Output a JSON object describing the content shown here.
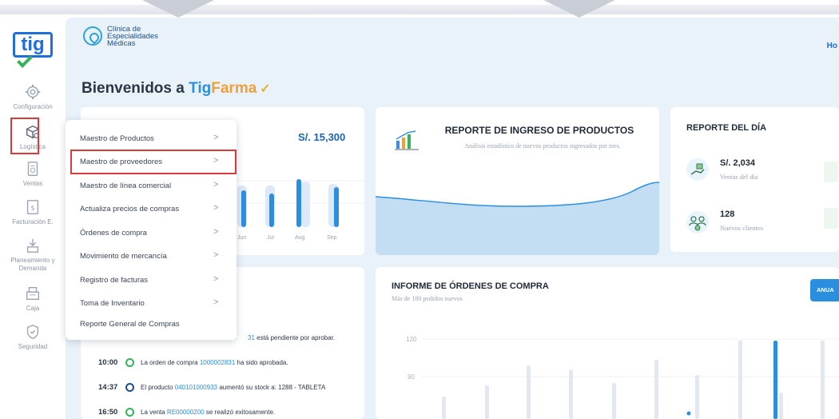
{
  "sidebar": {
    "items": [
      {
        "label": "Configuración",
        "icon": "gear-icon"
      },
      {
        "label": "Logística",
        "icon": "box-icon"
      },
      {
        "label": "Ventas",
        "icon": "receipt-icon"
      },
      {
        "label": "Facturación E.",
        "icon": "invoice-icon"
      },
      {
        "label": "Planeamiento y Demanda",
        "icon": "planning-icon"
      },
      {
        "label": "Caja",
        "icon": "cash-register-icon"
      },
      {
        "label": "Seguridad",
        "icon": "shield-icon"
      }
    ]
  },
  "header": {
    "clinic_name_1": "Clínica de",
    "clinic_name_2": "Especialidades",
    "clinic_name_3": "Médicas",
    "right_cut": "Ho",
    "welcome_prefix": "Bienvenidos a ",
    "brand_tig": "Tig",
    "brand_farma": "Farma",
    "check_mark": "✓"
  },
  "sales_card": {
    "amount": "S/. 15,300",
    "months": [
      "Jun",
      "Jul",
      "Aug",
      "Sep"
    ]
  },
  "report_card": {
    "title": "REPORTE DE INGRESO DE PRODUCTOS",
    "subtitle": "Análisis estadístico de nuevos productos ingresados por mes."
  },
  "day_card": {
    "title": "REPORTE DEL DÍA",
    "sales_value": "S/. 2,034",
    "sales_label": "Ventas del día",
    "clients_value": "128",
    "clients_label": "Nuevos clientes"
  },
  "activity": {
    "partial_link": "31",
    "partial_text": " está pendiente por aprobar.",
    "rows": [
      {
        "time": "10:00",
        "pre": "La orden de compra ",
        "link": "1000002831",
        "post": " ha sido aprobada.",
        "dot": "green"
      },
      {
        "time": "14:37",
        "pre": "El producto ",
        "link": "040101000933",
        "post": " aumentó su stock a: 1288 - TABLETA",
        "dot": "blue"
      },
      {
        "time": "16:50",
        "pre": "La venta ",
        "link": "RE00000200",
        "post": " se realizó exitosamente.",
        "dot": "green"
      }
    ]
  },
  "orders_card": {
    "title": "INFORME DE ÓRDENES DE COMPRA",
    "subtitle": "Más de 180 pedidos nuevos",
    "button": "ANUA",
    "y_ticks": [
      "120",
      "90"
    ]
  },
  "menu": {
    "items": [
      {
        "label": "Maestro de Productos",
        "chevron": ">"
      },
      {
        "label": "Maestro de proveedores",
        "chevron": ">"
      },
      {
        "label": "Maestro de línea comercial",
        "chevron": ">"
      },
      {
        "label": "Actualiza precios de compras",
        "chevron": ">"
      },
      {
        "label": "Órdenes de compra",
        "chevron": ">"
      },
      {
        "label": "Movimiento de mercancía",
        "chevron": ">"
      },
      {
        "label": "Registro de facturas",
        "chevron": ">"
      },
      {
        "label": "Toma de Inventario",
        "chevron": ">"
      },
      {
        "label": "Reporte General de Compras",
        "chevron": ""
      }
    ]
  },
  "colors": {
    "accent": "#2b8fe0",
    "brand_orange": "#f0a03a",
    "highlight_red": "#d93a3a",
    "success_green": "#34b35a"
  }
}
